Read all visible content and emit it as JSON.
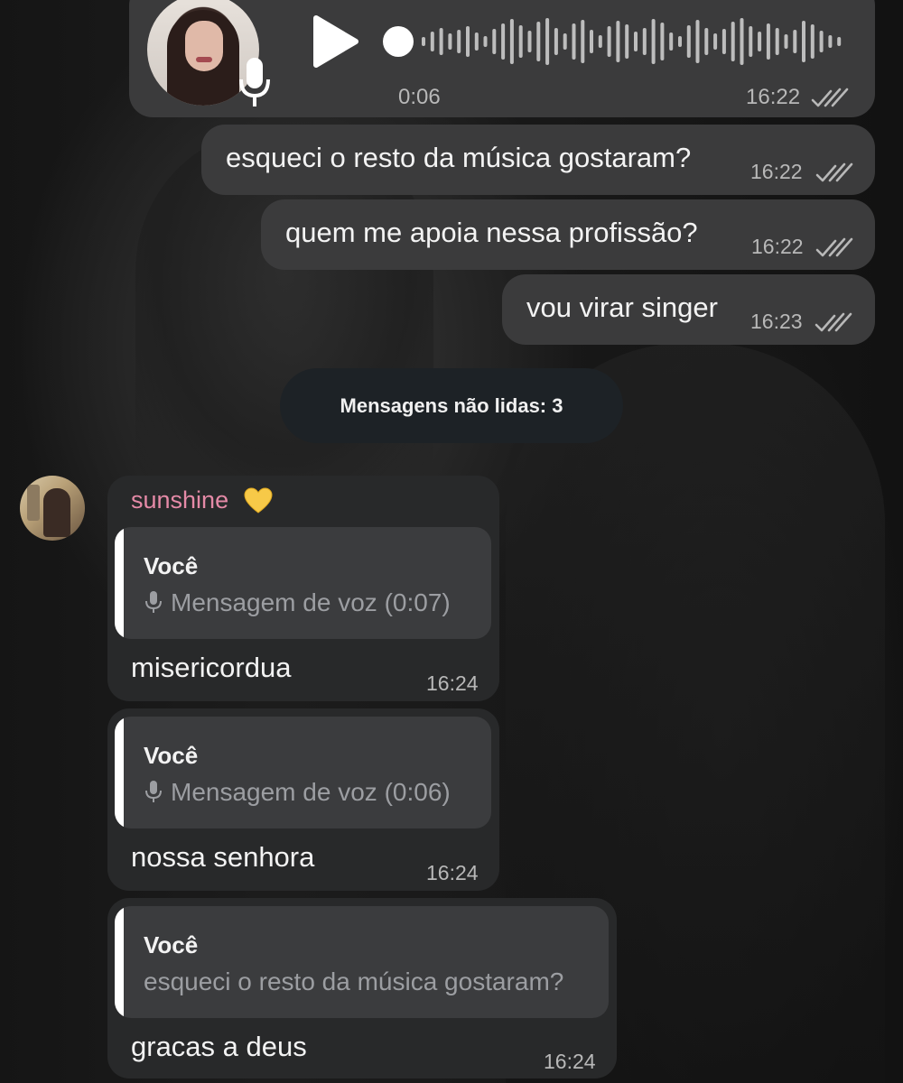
{
  "colors": {
    "outgoing_bubble": "#3b3b3c",
    "incoming_bubble": "#28292a",
    "sender_name": "#e58aa7",
    "unread_pill": "#1d2226"
  },
  "voice_message": {
    "duration": "0:06",
    "time": "16:22",
    "status_icon": "double-check-icon",
    "progress": 0.0
  },
  "outgoing_messages": [
    {
      "text": "esqueci o resto da música gostaram?",
      "time": "16:22"
    },
    {
      "text": "quem me apoia nessa profissão?",
      "time": "16:22"
    },
    {
      "text": "vou virar singer",
      "time": "16:23"
    }
  ],
  "unread_label": "Mensagens não lidas: 3",
  "sender": {
    "name": "sunshine",
    "emoji_icon": "yellow-heart-icon"
  },
  "incoming_messages": [
    {
      "reply_author": "Você",
      "reply_text": "Mensagem de voz (0:07)",
      "reply_is_voice": true,
      "text": "misericordua",
      "time": "16:24"
    },
    {
      "reply_author": "Você",
      "reply_text": "Mensagem de voz (0:06)",
      "reply_is_voice": true,
      "text": "nossa senhora",
      "time": "16:24"
    },
    {
      "reply_author": "Você",
      "reply_text": "esqueci o resto da música gostaram?",
      "reply_is_voice": false,
      "text": "gracas a deus",
      "time": "16:24"
    }
  ]
}
